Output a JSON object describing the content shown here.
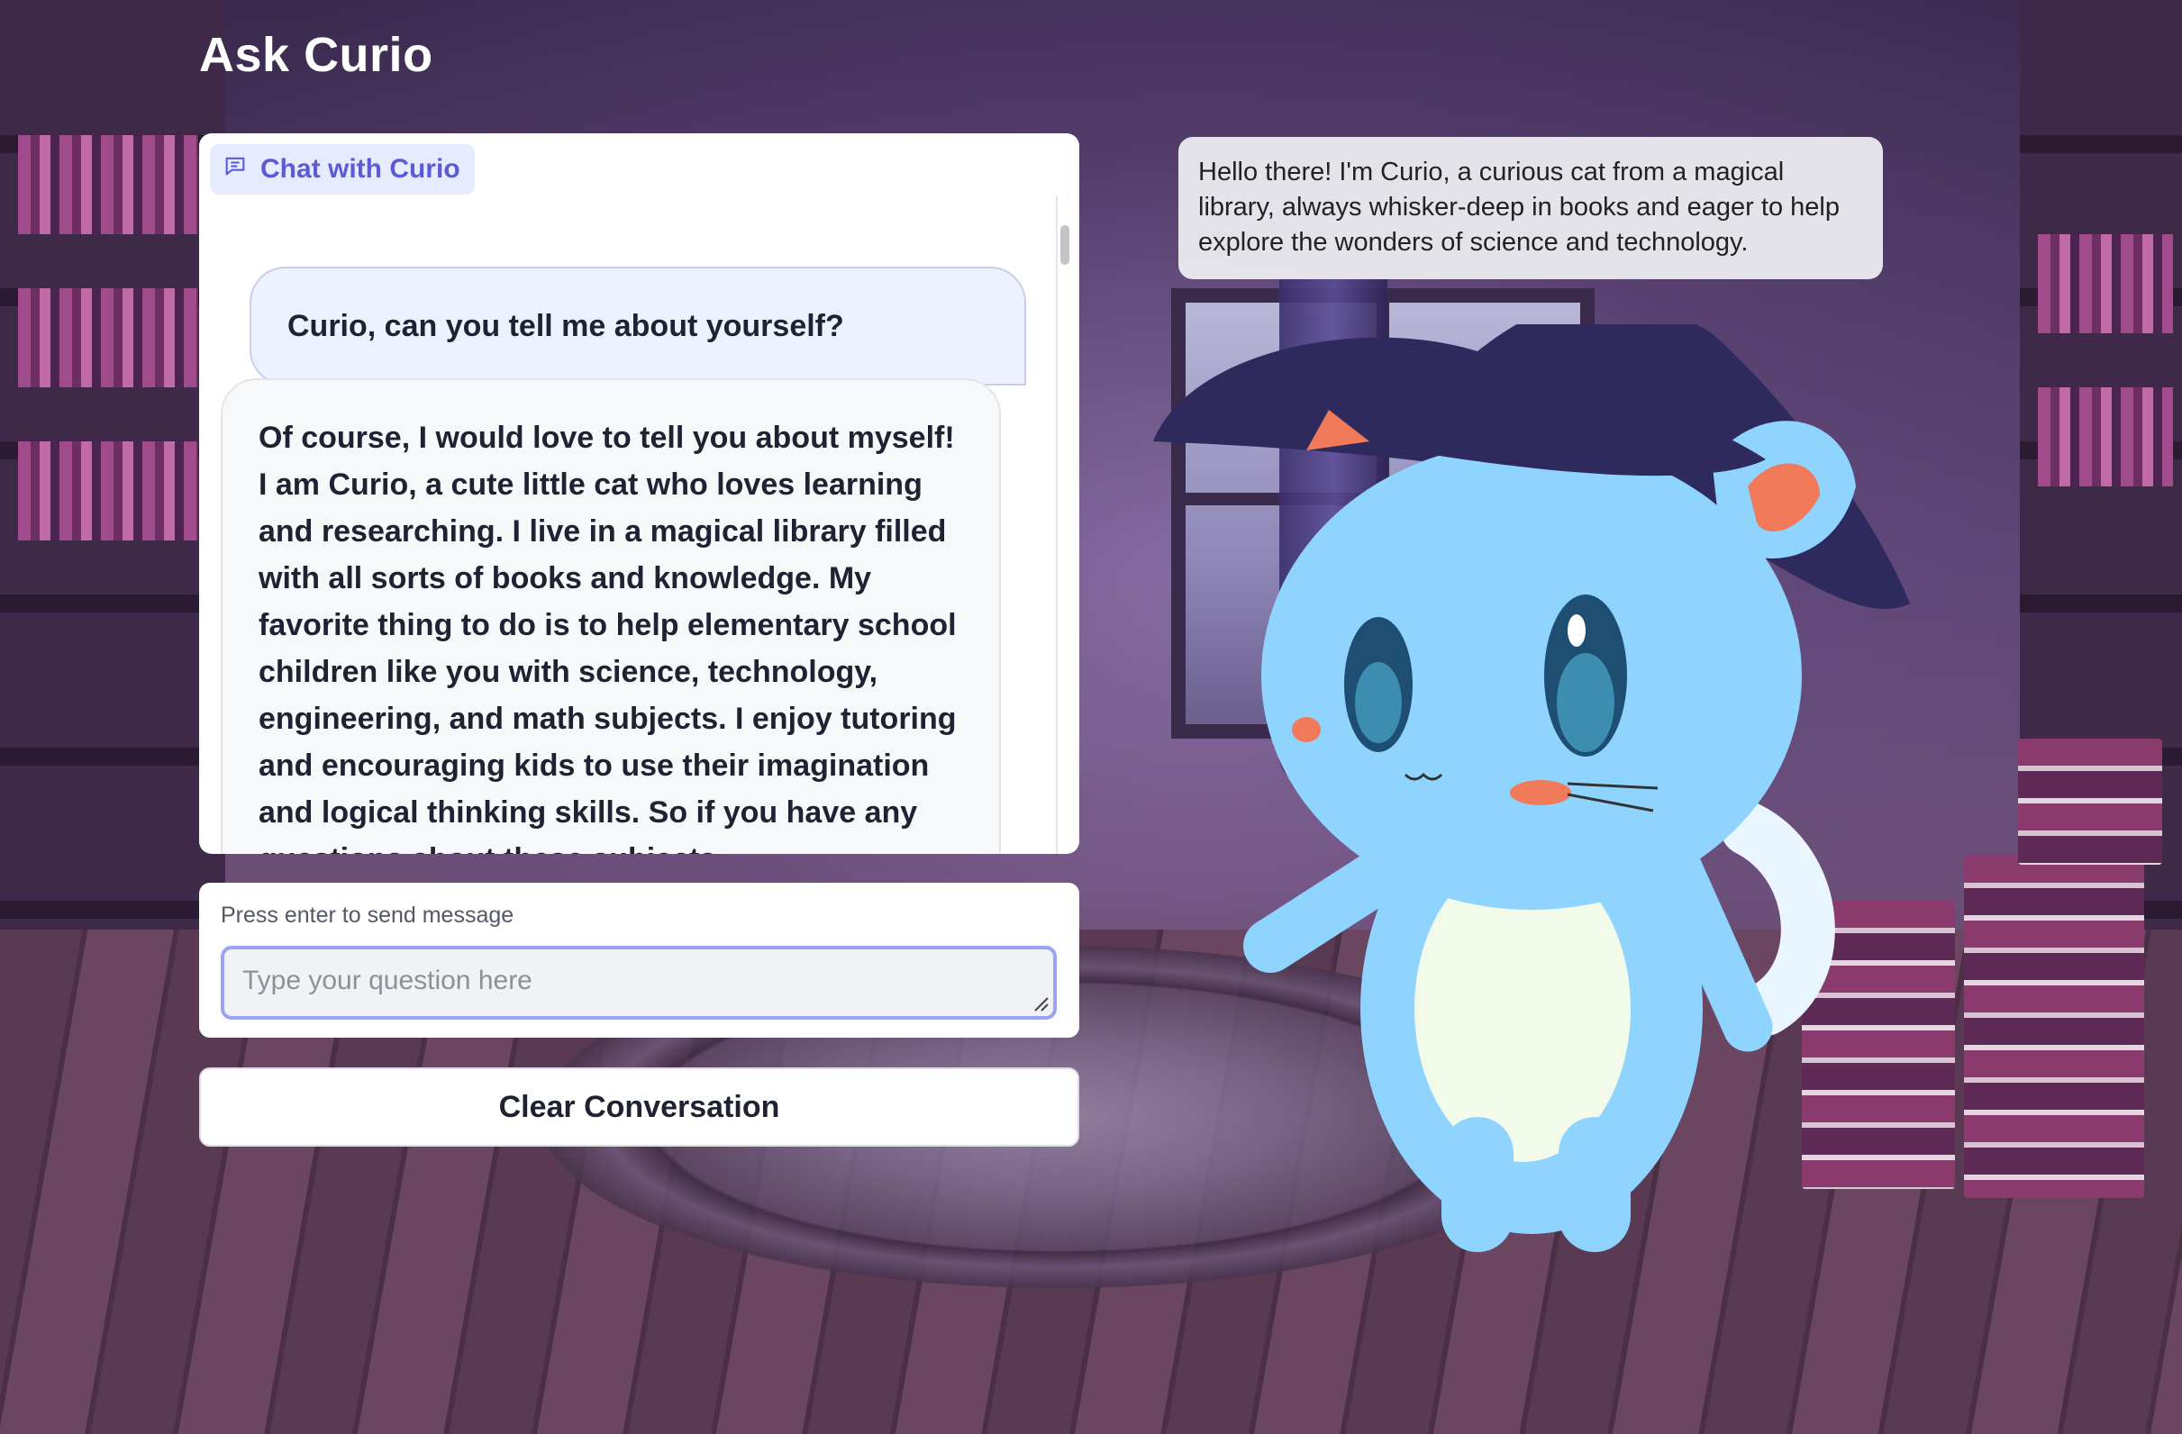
{
  "app": {
    "title": "Ask Curio"
  },
  "chat": {
    "label": "Chat with Curio",
    "label_icon": "chat-bubble-icon",
    "messages": [
      {
        "role": "user",
        "text": "Curio, can you tell me about yourself?"
      },
      {
        "role": "assistant",
        "text": "Of course, I would love to tell you about myself! I am Curio, a cute little cat who loves learning and researching. I live in a magical library filled with all sorts of books and knowledge. My favorite thing to do is to help elementary school children like you with science, technology, engineering, and math subjects. I enjoy tutoring and encouraging kids to use their imagination and logical thinking skills. So if you have any questions about these subjects"
      }
    ]
  },
  "input": {
    "hint": "Press enter to send message",
    "placeholder": "Type your question here",
    "value": ""
  },
  "buttons": {
    "clear": "Clear Conversation"
  },
  "speech_bubble": {
    "text": "Hello there! I'm Curio, a curious cat from a magical library, always whisker-deep in books and eager to help explore the wonders of science and technology."
  },
  "colors": {
    "accent": "#5b5bd6",
    "label_bg": "#e7ebff",
    "input_focus": "#9aa4f2",
    "cat_body": "#8fd3ff",
    "cat_hat": "#2f2a5e"
  }
}
